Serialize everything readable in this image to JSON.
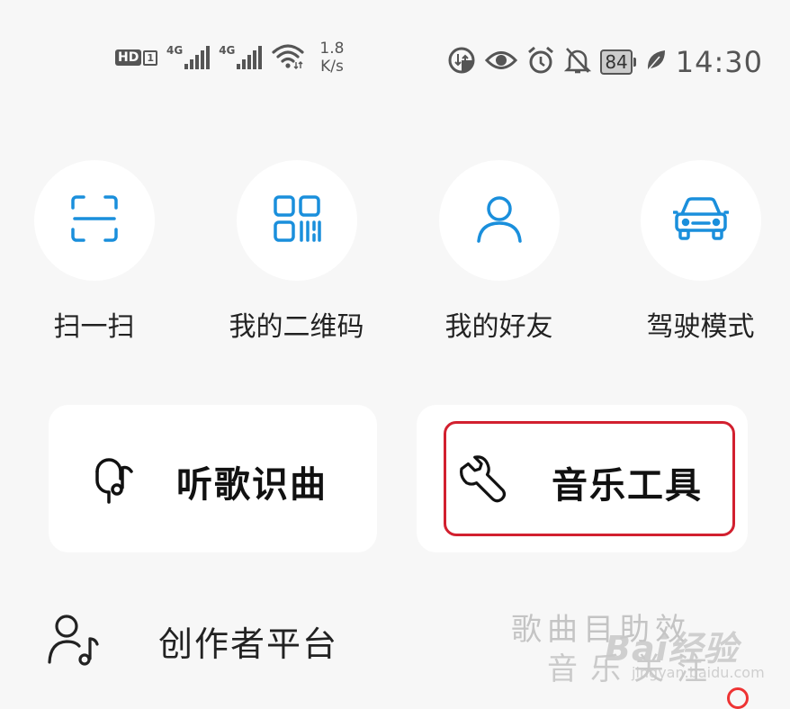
{
  "status_bar": {
    "hd_label": "HD",
    "hd_sim": "1",
    "network_1": "4G",
    "network_2": "4G",
    "speed_value": "1.8",
    "speed_unit": "K/s",
    "battery": "84",
    "time": "14:30",
    "icons": [
      "hd-icon",
      "signal-icon",
      "signal-icon",
      "wifi-icon",
      "data-saver-icon",
      "eye-comfort-icon",
      "alarm-icon",
      "mute-icon",
      "battery-icon",
      "leaf-icon"
    ]
  },
  "quick_actions": [
    {
      "label": "扫一扫",
      "icon": "scan-icon"
    },
    {
      "label": "我的二维码",
      "icon": "qr-code-icon"
    },
    {
      "label": "我的好友",
      "icon": "person-icon"
    },
    {
      "label": "驾驶模式",
      "icon": "car-icon"
    }
  ],
  "cards": {
    "recognize": {
      "label": "听歌识曲",
      "icon": "microphone-music-icon"
    },
    "tools": {
      "label": "音乐工具",
      "icon": "wrench-icon"
    }
  },
  "creator": {
    "label": "创作者平台",
    "icon": "creator-person-icon"
  },
  "faded_text": {
    "line1": "歌曲目助效",
    "line2": "音乐关注"
  },
  "watermark": {
    "logo": "Bai经验",
    "sub": "jingyan.baidu.com"
  },
  "colors": {
    "accent": "#1a8fdc",
    "highlight_border": "#d2202f",
    "background": "#f7f7f7"
  }
}
